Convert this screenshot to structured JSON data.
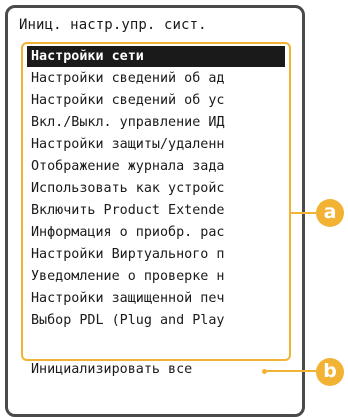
{
  "screen": {
    "title": "Иниц. настр.упр. сист."
  },
  "menu": {
    "items": [
      {
        "label": "Настройки сети",
        "selected": true
      },
      {
        "label": "Настройки сведений об ад"
      },
      {
        "label": "Настройки сведений об ус"
      },
      {
        "label": "Вкл./Выкл. управление ИД"
      },
      {
        "label": "Настройки защиты/удаленн"
      },
      {
        "label": "Отображение журнала зада"
      },
      {
        "label": "Использовать как устройс"
      },
      {
        "label": "Включить Product Extende"
      },
      {
        "label": "Информация о приобр. рас"
      },
      {
        "label": "Настройки Виртуального п"
      },
      {
        "label": "Уведомление о проверке н"
      },
      {
        "label": "Настройки защищенной печ"
      },
      {
        "label": "Выбор PDL (Plug and Play"
      }
    ]
  },
  "bottom": {
    "label": "Инициализировать все"
  },
  "callouts": {
    "a": "a",
    "b": "b"
  },
  "colors": {
    "accent": "#f2b233",
    "frame": "#4a4a4a",
    "selected_bg": "#1a1a1a"
  }
}
